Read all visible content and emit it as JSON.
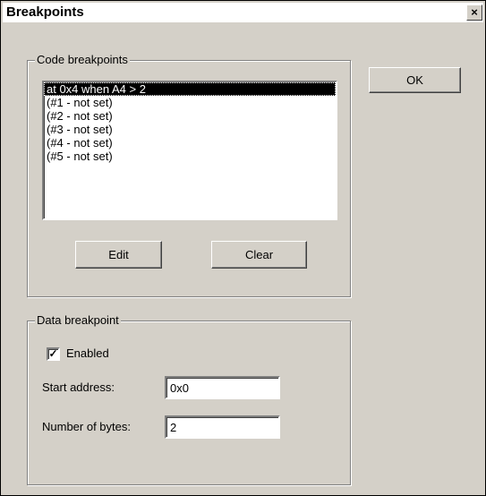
{
  "window": {
    "title": "Breakpoints",
    "close_glyph": "×"
  },
  "code_breakpoints": {
    "group_label": "Code breakpoints",
    "items": [
      "at 0x4 when A4 > 2",
      "(#1 - not set)",
      "(#2 - not set)",
      "(#3 - not set)",
      "(#4 - not set)",
      "(#5 - not set)"
    ],
    "selected_index": 0,
    "edit_label": "Edit",
    "clear_label": "Clear"
  },
  "ok_label": "OK",
  "data_breakpoint": {
    "group_label": "Data breakpoint",
    "enabled_label": "Enabled",
    "enabled_checked": true,
    "start_address_label": "Start address:",
    "start_address_value": "0x0",
    "num_bytes_label": "Number of bytes:",
    "num_bytes_value": "2"
  },
  "icons": {
    "checkbox": "checkmark-icon",
    "close": "close-icon"
  }
}
